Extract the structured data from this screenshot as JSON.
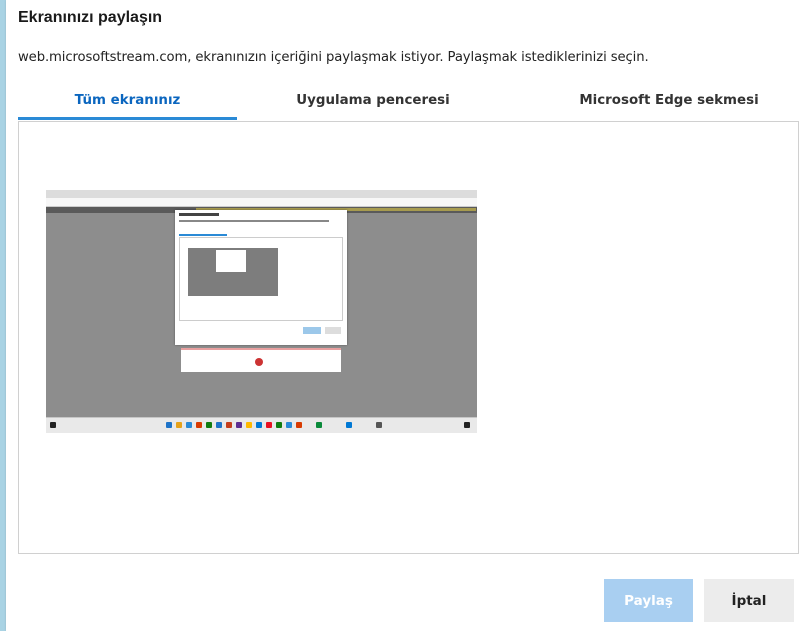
{
  "dialog": {
    "title": "Ekranınızı paylaşın",
    "subtitle": "web.microsoftstream.com, ekranınızın içeriğini paylaşmak istiyor. Paylaşmak istediklerinizi seçin."
  },
  "tabs": [
    {
      "label": "Tüm ekranınız",
      "active": true
    },
    {
      "label": "Uygulama penceresi",
      "active": false
    },
    {
      "label": "Microsoft Edge sekmesi",
      "active": false
    }
  ],
  "buttons": {
    "share_label": "Paylaş",
    "cancel_label": "İptal"
  },
  "colors": {
    "accent": "#2a8ad6",
    "active_tab_text": "#0b66bf",
    "share_button_disabled": "#a9cff1",
    "cancel_button": "#ececec"
  },
  "preview": {
    "icon": "screen-thumbnail"
  }
}
